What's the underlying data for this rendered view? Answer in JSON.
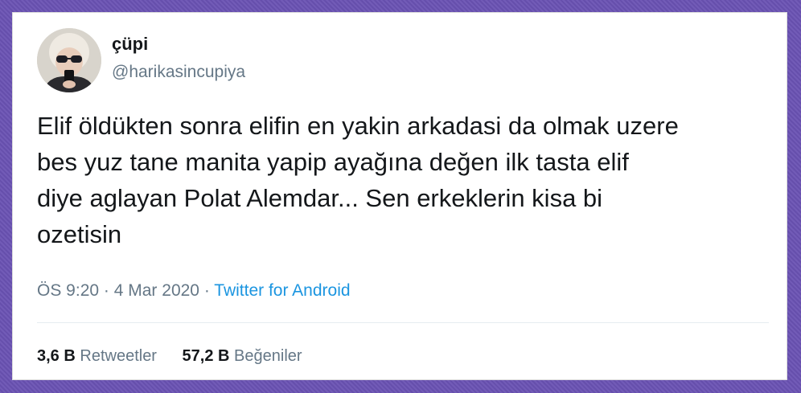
{
  "user": {
    "display_name": "çüpi",
    "handle": "@harikasincupiya"
  },
  "tweet": {
    "text": "Elif öldükten sonra elifin en yakin arkadasi da olmak uzere\nbes yuz tane manita yapip ayağına değen ilk tasta elif\ndiye aglayan Polat Alemdar... Sen erkeklerin kisa bi\nozetisin",
    "time": "ÖS 9:20",
    "separator": "·",
    "date": "4 Mar 2020",
    "source": "Twitter for Android"
  },
  "stats": {
    "retweets_count": "3,6 B",
    "retweets_label": "Retweetler",
    "likes_count": "57,2 B",
    "likes_label": "Beğeniler"
  },
  "colors": {
    "background": "#6a52b3",
    "text_primary": "#14171a",
    "text_secondary": "#657786",
    "link": "#1b95e0"
  }
}
